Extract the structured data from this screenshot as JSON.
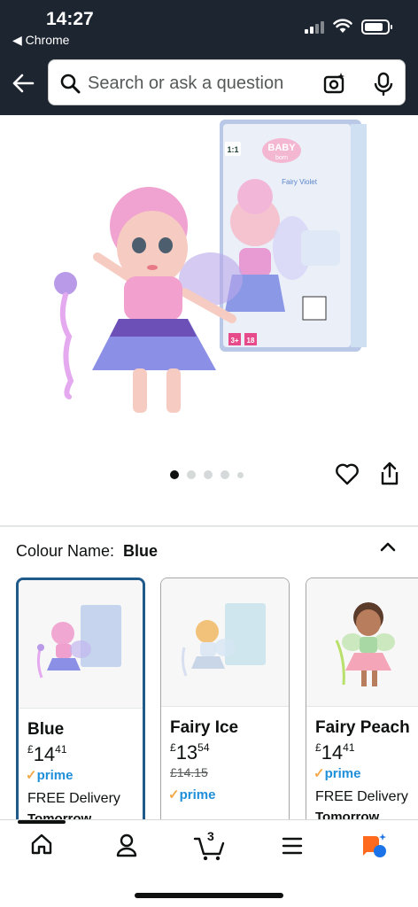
{
  "status": {
    "time": "14:27",
    "back_app": "◀ Chrome"
  },
  "search": {
    "placeholder": "Search or ask a question"
  },
  "carousel": {
    "dots": 5,
    "active": 0
  },
  "colour": {
    "label": "Colour Name:",
    "value": "Blue"
  },
  "box_text": {
    "brand": "BABY",
    "brand_sub": "born",
    "product": "Fairy Violet",
    "scale": "1:1",
    "age": "3+",
    "size": "18"
  },
  "variants": [
    {
      "name": "Blue",
      "currency": "£",
      "price_main": "14",
      "price_frac": "41",
      "prime": "prime",
      "delivery": "FREE Delivery",
      "delivery_day": "Tomorrow",
      "selected": true
    },
    {
      "name": "Fairy Ice",
      "currency": "£",
      "price_main": "13",
      "price_frac": "54",
      "list_price": "£14.15",
      "prime": "prime",
      "selected": false
    },
    {
      "name": "Fairy Peach",
      "currency": "£",
      "price_main": "14",
      "price_frac": "41",
      "prime": "prime",
      "delivery": "FREE Delivery",
      "delivery_day": "Tomorrow",
      "selected": false
    }
  ],
  "nav": {
    "cart_count": "3"
  },
  "colors": {
    "header_bg": "#1c2530",
    "selected_border": "#1f5a8b",
    "prime_blue": "#1f8fd9",
    "prime_tick": "#f3a847"
  }
}
